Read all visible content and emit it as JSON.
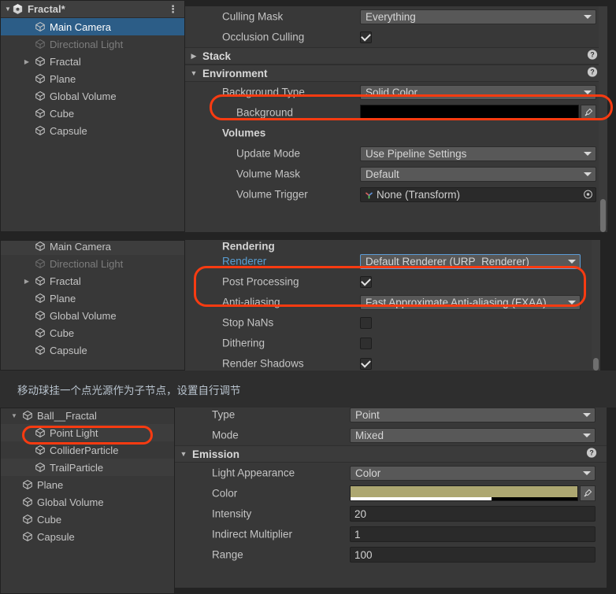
{
  "app": {
    "name": "Unity Editor",
    "theme": "dark"
  },
  "colors": {
    "accent_selection": "#2c5d87",
    "annotation_red": "#f93b11",
    "link_blue": "#5a9fd4",
    "light_color_swatch": "#ada771",
    "panel_bg": "#383838"
  },
  "sections": [
    {
      "id": "camera-section",
      "hierarchy": {
        "header": {
          "label": "Fractal*",
          "icon": "unity-scene-icon",
          "menu_icon": "kebab-menu-icon"
        },
        "items": [
          {
            "label": "Main Camera",
            "icon": "gameobject-cube-icon",
            "depth": 1,
            "selected": true,
            "dimmed": false,
            "expandable": false,
            "expanded": false
          },
          {
            "label": "Directional Light",
            "icon": "gameobject-cube-icon",
            "depth": 1,
            "selected": false,
            "dimmed": true,
            "expandable": false,
            "expanded": false
          },
          {
            "label": "Fractal",
            "icon": "gameobject-cube-icon",
            "depth": 1,
            "selected": false,
            "dimmed": false,
            "expandable": true,
            "expanded": false
          },
          {
            "label": "Plane",
            "icon": "gameobject-cube-icon",
            "depth": 1,
            "selected": false,
            "dimmed": false,
            "expandable": false,
            "expanded": false
          },
          {
            "label": "Global Volume",
            "icon": "gameobject-cube-icon",
            "depth": 1,
            "selected": false,
            "dimmed": false,
            "expandable": false,
            "expanded": false
          },
          {
            "label": "Cube",
            "icon": "gameobject-cube-icon",
            "depth": 1,
            "selected": false,
            "dimmed": false,
            "expandable": false,
            "expanded": false
          },
          {
            "label": "Capsule",
            "icon": "gameobject-cube-icon",
            "depth": 1,
            "selected": false,
            "dimmed": false,
            "expandable": false,
            "expanded": false
          }
        ]
      },
      "inspector": {
        "rows": [
          {
            "kind": "field",
            "label": "Culling Mask",
            "control": "dropdown",
            "value": "Everything"
          },
          {
            "kind": "field",
            "label": "Occlusion Culling",
            "control": "checkbox",
            "checked": true
          },
          {
            "kind": "foldout",
            "label": "Stack",
            "expanded": false,
            "help": "?"
          },
          {
            "kind": "foldout",
            "label": "Environment",
            "expanded": true,
            "help": "?"
          },
          {
            "kind": "field",
            "label": "Background Type",
            "control": "dropdown",
            "value": "Solid Color",
            "highlighted": true
          },
          {
            "kind": "field",
            "label": "Background",
            "control": "color-black",
            "indent": true,
            "eyedropper": true
          },
          {
            "kind": "header",
            "label": "Volumes"
          },
          {
            "kind": "field",
            "label": "Update Mode",
            "control": "dropdown",
            "value": "Use Pipeline Settings",
            "indent": true
          },
          {
            "kind": "field",
            "label": "Volume Mask",
            "control": "dropdown",
            "value": "Default",
            "indent": true
          },
          {
            "kind": "field",
            "label": "Volume Trigger",
            "control": "object",
            "value": "None (Transform)",
            "indent": true,
            "icon": "transform-axis-icon"
          }
        ]
      }
    },
    {
      "id": "rendering-section",
      "hierarchy": {
        "items": [
          {
            "label": "Main Camera",
            "icon": "gameobject-cube-icon",
            "depth": 1,
            "selected": false,
            "dimmed": false,
            "expandable": false,
            "expanded": false,
            "alt": true
          },
          {
            "label": "Directional Light",
            "icon": "gameobject-cube-icon",
            "depth": 1,
            "selected": false,
            "dimmed": true,
            "expandable": false,
            "expanded": false
          },
          {
            "label": "Fractal",
            "icon": "gameobject-cube-icon",
            "depth": 1,
            "selected": false,
            "dimmed": false,
            "expandable": true,
            "expanded": false
          },
          {
            "label": "Plane",
            "icon": "gameobject-cube-icon",
            "depth": 1,
            "selected": false,
            "dimmed": false,
            "expandable": false,
            "expanded": false
          },
          {
            "label": "Global Volume",
            "icon": "gameobject-cube-icon",
            "depth": 1,
            "selected": false,
            "dimmed": false,
            "expandable": false,
            "expanded": false
          },
          {
            "label": "Cube",
            "icon": "gameobject-cube-icon",
            "depth": 1,
            "selected": false,
            "dimmed": false,
            "expandable": false,
            "expanded": false
          },
          {
            "label": "Capsule",
            "icon": "gameobject-cube-icon",
            "depth": 1,
            "selected": false,
            "dimmed": false,
            "expandable": false,
            "expanded": false
          }
        ]
      },
      "inspector": {
        "clipped_header": "Rendering",
        "rows": [
          {
            "kind": "field",
            "label": "Renderer",
            "control": "dropdown",
            "value": "Default Renderer (URP_Renderer)",
            "label_blue": true,
            "focused": true
          },
          {
            "kind": "field",
            "label": "Post Processing",
            "control": "checkbox",
            "checked": true,
            "highlighted": true
          },
          {
            "kind": "field",
            "label": "Anti-aliasing",
            "control": "dropdown",
            "value": "Fast Approximate Anti-aliasing (FXAA)",
            "highlighted": true
          },
          {
            "kind": "field",
            "label": "Stop NaNs",
            "control": "checkbox",
            "checked": false
          },
          {
            "kind": "field",
            "label": "Dithering",
            "control": "checkbox",
            "checked": false
          },
          {
            "kind": "field",
            "label": "Render Shadows",
            "control": "checkbox",
            "checked": true
          }
        ]
      }
    },
    {
      "id": "light-section",
      "hierarchy": {
        "items": [
          {
            "label": "Ball__Fractal",
            "icon": "gameobject-cube-icon",
            "depth": 0,
            "selected": false,
            "dimmed": false,
            "expandable": true,
            "expanded": true
          },
          {
            "label": "Point Light",
            "icon": "gameobject-cube-icon",
            "depth": 1,
            "selected": false,
            "dimmed": false,
            "expandable": false,
            "expanded": false,
            "alt": true,
            "highlighted": true
          },
          {
            "label": "ColliderParticle",
            "icon": "gameobject-cube-icon",
            "depth": 1,
            "selected": false,
            "dimmed": false,
            "expandable": false,
            "expanded": false
          },
          {
            "label": "TrailParticle",
            "icon": "gameobject-cube-icon",
            "depth": 1,
            "selected": false,
            "dimmed": false,
            "expandable": false,
            "expanded": false,
            "alt": true
          },
          {
            "label": "Plane",
            "icon": "gameobject-cube-icon",
            "depth": 0,
            "selected": false,
            "dimmed": false,
            "expandable": false,
            "expanded": false
          },
          {
            "label": "Global Volume",
            "icon": "gameobject-cube-icon",
            "depth": 0,
            "selected": false,
            "dimmed": false,
            "expandable": false,
            "expanded": false
          },
          {
            "label": "Cube",
            "icon": "gameobject-cube-icon",
            "depth": 0,
            "selected": false,
            "dimmed": false,
            "expandable": false,
            "expanded": false
          },
          {
            "label": "Capsule",
            "icon": "gameobject-cube-icon",
            "depth": 0,
            "selected": false,
            "dimmed": false,
            "expandable": false,
            "expanded": false
          }
        ]
      },
      "inspector": {
        "rows": [
          {
            "kind": "field",
            "label": "Type",
            "control": "dropdown",
            "value": "Point"
          },
          {
            "kind": "field",
            "label": "Mode",
            "control": "dropdown",
            "value": "Mixed"
          },
          {
            "kind": "foldout",
            "label": "Emission",
            "expanded": true,
            "help": "?"
          },
          {
            "kind": "field",
            "label": "Light Appearance",
            "control": "dropdown",
            "value": "Color"
          },
          {
            "kind": "field",
            "label": "Color",
            "control": "color",
            "value": "#ada771",
            "alpha": 0.62,
            "eyedropper": true
          },
          {
            "kind": "field",
            "label": "Intensity",
            "control": "number",
            "value": "20"
          },
          {
            "kind": "field",
            "label": "Indirect Multiplier",
            "control": "number",
            "value": "1"
          },
          {
            "kind": "field",
            "label": "Range",
            "control": "number",
            "value": "100"
          }
        ]
      }
    }
  ],
  "caption": {
    "text": "移动球挂一个点光源作为子节点，设置自行调节"
  }
}
